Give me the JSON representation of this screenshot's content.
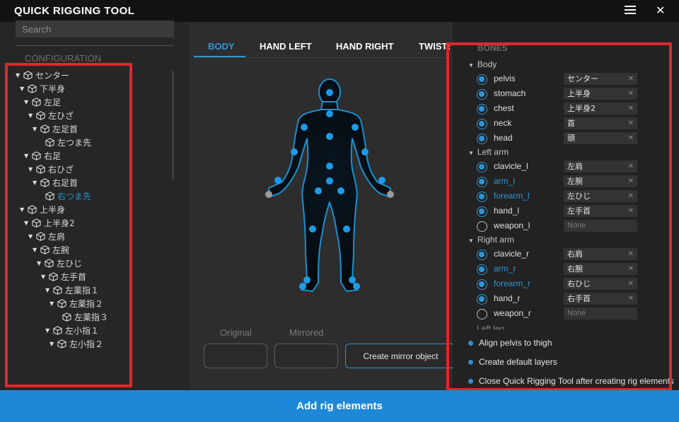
{
  "app": {
    "title": "QUICK RIGGING TOOL"
  },
  "search": {
    "placeholder": "Search"
  },
  "configuration": {
    "label": "CONFIGURATION",
    "tree": [
      {
        "label": "センター",
        "depth": 0
      },
      {
        "label": "下半身",
        "depth": 1
      },
      {
        "label": "左足",
        "depth": 2
      },
      {
        "label": "左ひざ",
        "depth": 3
      },
      {
        "label": "左足首",
        "depth": 4
      },
      {
        "label": "左つま先",
        "depth": 5,
        "leaf": true
      },
      {
        "label": "右足",
        "depth": 2
      },
      {
        "label": "右ひざ",
        "depth": 3
      },
      {
        "label": "右足首",
        "depth": 4
      },
      {
        "label": "右つま先",
        "depth": 5,
        "leaf": true,
        "selected": true
      },
      {
        "label": "上半身",
        "depth": 1
      },
      {
        "label": "上半身2",
        "depth": 2
      },
      {
        "label": "左肩",
        "depth": 3
      },
      {
        "label": "左腕",
        "depth": 4
      },
      {
        "label": "左ひじ",
        "depth": 5
      },
      {
        "label": "左手首",
        "depth": 6
      },
      {
        "label": "左薬指１",
        "depth": 7
      },
      {
        "label": "左薬指２",
        "depth": 8
      },
      {
        "label": "左薬指３",
        "depth": 9,
        "leaf": true
      },
      {
        "label": "左小指１",
        "depth": 7
      },
      {
        "label": "左小指２",
        "depth": 8
      }
    ]
  },
  "tabs": [
    "BODY",
    "HAND LEFT",
    "HAND RIGHT",
    "TWISTS"
  ],
  "active_tab": "BODY",
  "mirror": {
    "original_label": "Original",
    "mirrored_label": "Mirrored",
    "button_label": "Create mirror object"
  },
  "bones": {
    "label": "BONES",
    "groups": [
      {
        "name": "Body",
        "items": [
          {
            "name": "pelvis",
            "value": "センター",
            "checked": true,
            "highlight": false
          },
          {
            "name": "stomach",
            "value": "上半身",
            "checked": true,
            "highlight": false
          },
          {
            "name": "chest",
            "value": "上半身2",
            "checked": true,
            "highlight": false
          },
          {
            "name": "neck",
            "value": "首",
            "checked": true,
            "highlight": false
          },
          {
            "name": "head",
            "value": "頭",
            "checked": true,
            "highlight": false
          }
        ]
      },
      {
        "name": "Left arm",
        "items": [
          {
            "name": "clavicle_l",
            "value": "左肩",
            "checked": true,
            "highlight": false
          },
          {
            "name": "arm_l",
            "value": "左腕",
            "checked": true,
            "highlight": true
          },
          {
            "name": "forearm_l",
            "value": "左ひじ",
            "checked": true,
            "highlight": true
          },
          {
            "name": "hand_l",
            "value": "左手首",
            "checked": true,
            "highlight": false
          },
          {
            "name": "weapon_l",
            "value": "None",
            "checked": false,
            "highlight": false
          }
        ]
      },
      {
        "name": "Right arm",
        "items": [
          {
            "name": "clavicle_r",
            "value": "右肩",
            "checked": true,
            "highlight": false
          },
          {
            "name": "arm_r",
            "value": "右腕",
            "checked": true,
            "highlight": true
          },
          {
            "name": "forearm_r",
            "value": "右ひじ",
            "checked": true,
            "highlight": true
          },
          {
            "name": "hand_r",
            "value": "右手首",
            "checked": true,
            "highlight": false
          },
          {
            "name": "weapon_r",
            "value": "None",
            "checked": false,
            "highlight": false
          }
        ]
      }
    ],
    "next_group_partial": "Left leg"
  },
  "options": [
    "Align pelvis to thigh",
    "Create default layers",
    "Close Quick Rigging Tool after creating rig elements"
  ],
  "action": {
    "label": "Add rig elements"
  },
  "colors": {
    "accent": "#2f96d6",
    "highlight_box": "#e3262a",
    "action_bar": "#1e88d8"
  }
}
